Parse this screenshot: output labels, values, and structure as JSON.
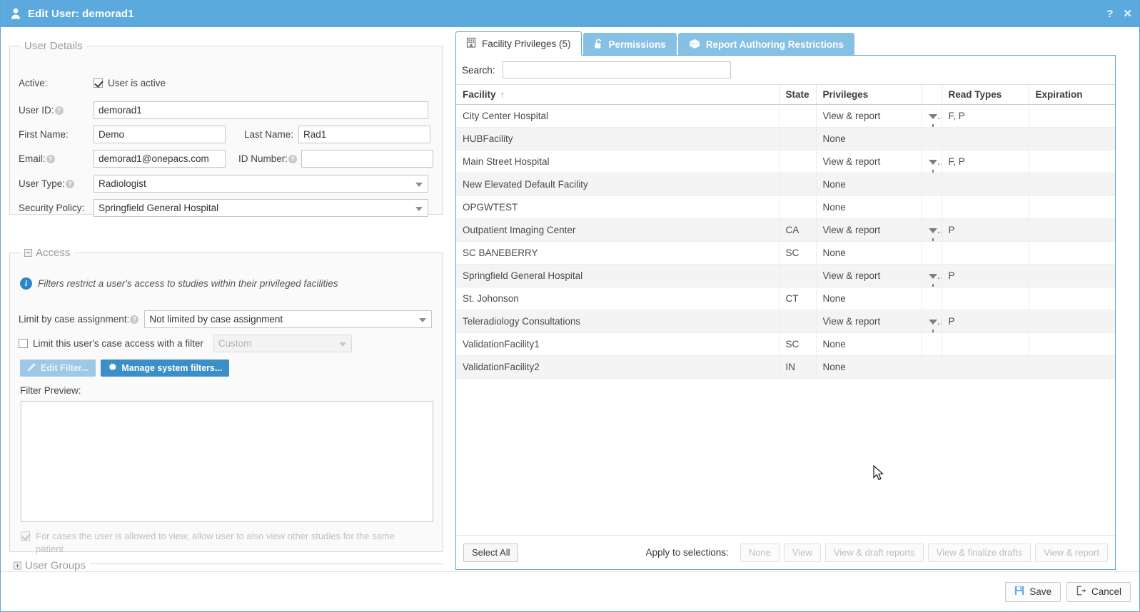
{
  "window": {
    "title": "Edit User: demorad1",
    "title_icon": "user-icon",
    "help_label": "?",
    "close_label": "✕"
  },
  "user_details": {
    "legend": "User Details",
    "active_label": "Active:",
    "active_checkbox_label": "User is active",
    "active_checked": true,
    "user_id_label": "User ID:",
    "user_id_value": "demorad1",
    "first_name_label": "First Name:",
    "first_name_value": "Demo",
    "last_name_label": "Last Name:",
    "last_name_value": "Rad1",
    "email_label": "Email:",
    "email_value": "demorad1@onepacs.com",
    "id_number_label": "ID Number:",
    "id_number_value": "",
    "user_type_label": "User Type:",
    "user_type_value": "Radiologist",
    "security_policy_label": "Security Policy:",
    "security_policy_value": "Springfield General Hospital"
  },
  "access": {
    "legend": "Access",
    "info_text": "Filters restrict a user's access to studies within their privileged facilities",
    "limit_case_assignment_label": "Limit by case assignment:",
    "limit_case_assignment_value": "Not limited by case assignment",
    "limit_filter_checkbox_label": "Limit this user's case access with a filter",
    "limit_filter_checked": false,
    "custom_filter_value": "Custom",
    "edit_filter_button": "Edit Filter...",
    "manage_filters_button": "Manage system filters...",
    "filter_preview_label": "Filter Preview:",
    "filter_preview_value": "",
    "same_patient_checkbox_label": "For cases the user is allowed to view, allow user to also view other studies for the same patient",
    "same_patient_checked": true
  },
  "user_groups": {
    "legend": "User Groups"
  },
  "tabs": [
    {
      "label": "Facility Privileges (5)",
      "icon": "building-icon",
      "active": true
    },
    {
      "label": "Permissions",
      "icon": "unlock-icon",
      "active": false
    },
    {
      "label": "Report Authoring Restrictions",
      "icon": "box-icon",
      "active": false
    }
  ],
  "search": {
    "label": "Search:",
    "value": "",
    "placeholder": ""
  },
  "table": {
    "columns": [
      "Facility",
      "State",
      "Privileges",
      "",
      "Read Types",
      "Expiration"
    ],
    "sort_column": "Facility",
    "sort_direction": "↑",
    "rows": [
      {
        "facility": "City Center Hospital",
        "state": "",
        "privileges": "View & report",
        "filter_icon": true,
        "read_types": "F, P",
        "expiration": ""
      },
      {
        "facility": "HUBFacility",
        "state": "",
        "privileges": "None",
        "filter_icon": false,
        "read_types": "",
        "expiration": ""
      },
      {
        "facility": "Main Street Hospital",
        "state": "",
        "privileges": "View & report",
        "filter_icon": true,
        "read_types": "F, P",
        "expiration": ""
      },
      {
        "facility": "New Elevated Default Facility",
        "state": "",
        "privileges": "None",
        "filter_icon": false,
        "read_types": "",
        "expiration": ""
      },
      {
        "facility": "OPGWTEST",
        "state": "",
        "privileges": "None",
        "filter_icon": false,
        "read_types": "",
        "expiration": ""
      },
      {
        "facility": "Outpatient Imaging Center",
        "state": "CA",
        "privileges": "View & report",
        "filter_icon": true,
        "read_types": "P",
        "expiration": ""
      },
      {
        "facility": "SC BANEBERRY",
        "state": "SC",
        "privileges": "None",
        "filter_icon": false,
        "read_types": "",
        "expiration": ""
      },
      {
        "facility": "Springfield General Hospital",
        "state": "",
        "privileges": "View & report",
        "filter_icon": true,
        "read_types": "P",
        "expiration": ""
      },
      {
        "facility": "St. Johonson",
        "state": "CT",
        "privileges": "None",
        "filter_icon": false,
        "read_types": "",
        "expiration": ""
      },
      {
        "facility": "Teleradiology Consultations",
        "state": "",
        "privileges": "View & report",
        "filter_icon": true,
        "read_types": "P",
        "expiration": ""
      },
      {
        "facility": "ValidationFacility1",
        "state": "SC",
        "privileges": "None",
        "filter_icon": false,
        "read_types": "",
        "expiration": ""
      },
      {
        "facility": "ValidationFacility2",
        "state": "IN",
        "privileges": "None",
        "filter_icon": false,
        "read_types": "",
        "expiration": ""
      }
    ]
  },
  "table_toolbar": {
    "select_all": "Select All",
    "apply_label": "Apply to selections:",
    "apply_buttons": [
      "None",
      "View",
      "View & draft reports",
      "View & finalize drafts",
      "View & report"
    ]
  },
  "footer": {
    "save_label": "Save",
    "cancel_label": "Cancel",
    "save_icon": "save-icon",
    "cancel_icon": "exit-icon"
  },
  "colors": {
    "accent": "#5ca9dd",
    "tab_inactive": "#86c0e4",
    "button_blue": "#3b8fc9",
    "info_blue": "#2e86c8",
    "sort_arrow": "#c08a3e"
  }
}
